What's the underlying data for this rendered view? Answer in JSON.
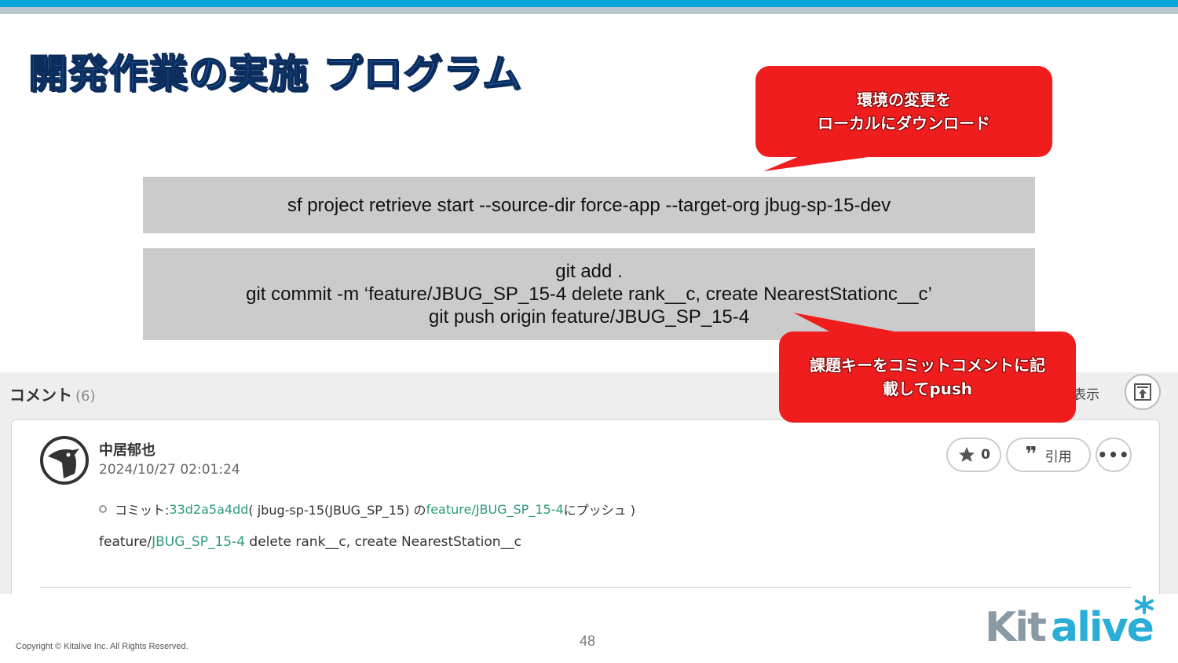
{
  "title": "開発作業の実施 プログラム",
  "commands": {
    "retrieve": "sf project retrieve start --source-dir force-app --target-org jbug-sp-15-dev",
    "git_lines": [
      "git add .",
      "git commit -m ‘feature/JBUG_SP_15-4 delete rank__c, create NearestStationc__c’",
      "git push origin feature/JBUG_SP_15-4"
    ]
  },
  "callouts": {
    "top": {
      "line1": "環境の変更を",
      "line2": "ローカルにダウンロード"
    },
    "bottom": {
      "line1": "課題キーをコミットコメントに記",
      "line2": "載してpush"
    }
  },
  "comment_panel": {
    "header": "コメント",
    "count": "(6)",
    "show_label": "表示",
    "author": "中居郁也",
    "timestamp": "2024/10/27 02:01:24",
    "commit": {
      "prefix": "コミット: ",
      "hash": "33d2a5a4dd",
      "repo": "( jbug-sp-15(JBUG_SP_15) の ",
      "branch": "feature/JBUG_SP_15-4",
      "suffix": " にプッシュ )"
    },
    "message": {
      "prefix": "feature/",
      "key": "JBUG_SP_15-4",
      "rest": " delete rank__c, create NearestStation__c"
    },
    "star_count": "0",
    "quote_label": "引用"
  },
  "footer": {
    "copyright": "Copyright © Kitalive Inc. All Rights Reserved.",
    "page": "48"
  },
  "logo_text": "Kitalive",
  "colors": {
    "accent_blue": "#0aa6d9",
    "callout_red": "#f01d1e",
    "link_green": "#2c9a7c",
    "title_blue": "#1f5aa6"
  }
}
